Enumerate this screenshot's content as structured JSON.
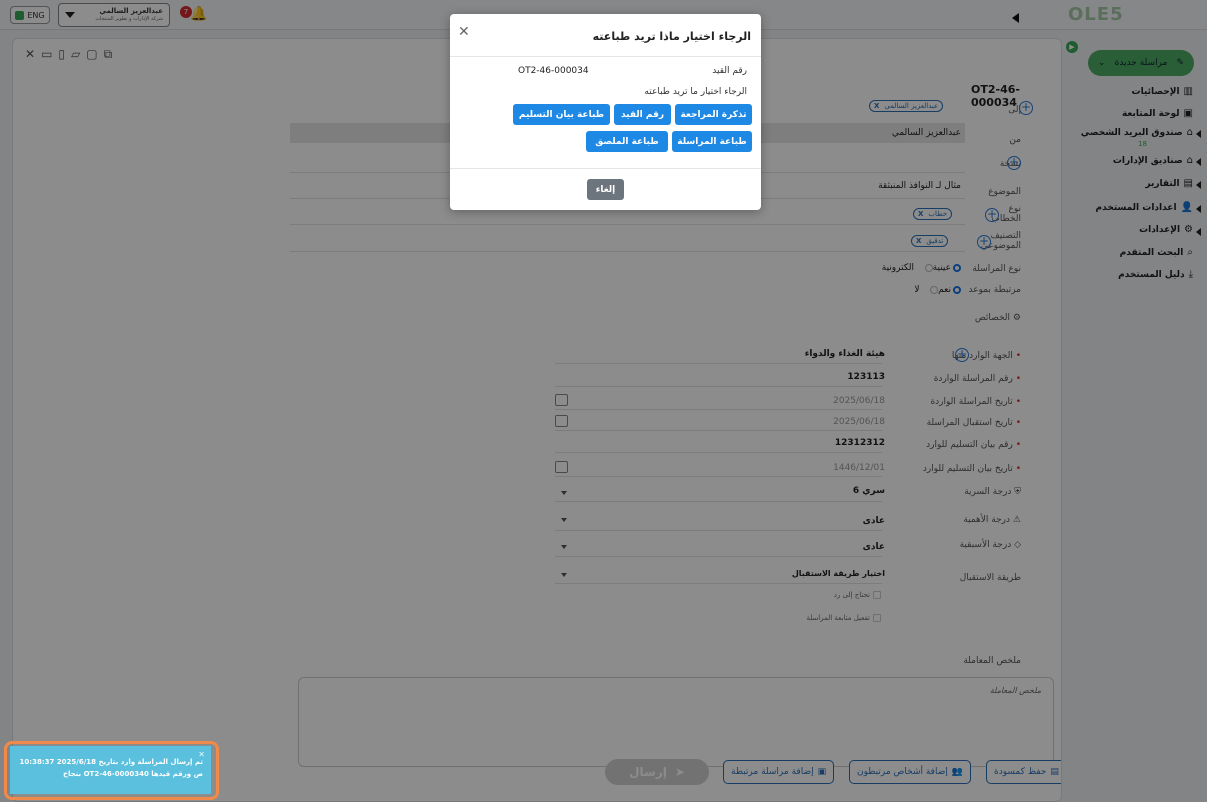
{
  "topbar": {
    "lang": "ENG",
    "user_name": "عبدالعزيز السالمي",
    "user_subtitle": "شركة الإدارات و تطوير المنتجات",
    "notif_count": "7",
    "logo": "OLE5"
  },
  "sidebar": {
    "new_button": "مراسلة جديدة",
    "items": [
      {
        "label": "الإحصائيات",
        "icon": "bar-chart-icon"
      },
      {
        "label": "لوحة المتابعة",
        "icon": "monitor-icon"
      },
      {
        "label": "صندوق البريد الشخصي",
        "icon": "inbox-icon",
        "count": "18"
      },
      {
        "label": "صناديق الإدارات",
        "icon": "inbox-icon"
      },
      {
        "label": "التقارير",
        "icon": "report-icon"
      },
      {
        "label": "اعدادات المستخدم",
        "icon": "user-settings-icon"
      },
      {
        "label": "الإعدادات",
        "icon": "gear-icon"
      },
      {
        "label": "البحث المتقدم",
        "icon": "search-icon"
      },
      {
        "label": "دليل المستخدم",
        "icon": "download-icon"
      }
    ]
  },
  "form": {
    "doc_number": "OT2-46-000034",
    "to_label": "إلى",
    "to_chip": "عبدالعزيز السالمي",
    "from_label": "من",
    "from_value": "عبدالعزيز السالمي",
    "cc_label": "نسخة",
    "subject_label": "الموضوع",
    "subject_value": "مثال لـ النوافذ المنبثقة",
    "letter_type_label": "نوع الخطاب",
    "letter_type_chip": "خطاب",
    "classification_label": "التصنيف الموضوعي",
    "classification_chip": "تدقيق",
    "mail_type_label": "نوع المراسلة",
    "mail_type_options": [
      "الكترونية",
      "عينية"
    ],
    "linked_label": "مرتبطة بموعد",
    "linked_options": [
      "نعم",
      "لا"
    ],
    "properties_label": "الخصائص",
    "sender_label": "الجهة الوارد منها",
    "sender_value": "هيئة الغذاء والدواء",
    "incoming_no_label": "رقم المراسلة الواردة",
    "incoming_no_value": "123113",
    "incoming_date_label": "تاريخ المراسلة الواردة",
    "incoming_date_value": "2025/06/18",
    "received_date_label": "تاريخ استقبال المراسلة",
    "received_date_value": "2025/06/18",
    "delivery_no_label": "رقم بيان التسليم للوارد",
    "delivery_no_value": "12312312",
    "delivery_date_label": "تاريخ بيان التسليم للوارد",
    "delivery_date_value": "1446/12/01",
    "secrecy_label": "درجة السرية",
    "secrecy_value": "سري 6",
    "importance_label": "درجة الأهمية",
    "importance_value": "عادى",
    "priority_label": "درجة الأسبقية",
    "priority_value": "عادى",
    "receive_method_label": "طريقة الاستقبال",
    "receive_method_value": "اختيار طريقة الاستقبال",
    "needs_reply": "تحتاج إلى رد",
    "enable_followup": "تفعيل متابعة المراسلة",
    "summary_label": "ملخص المعاملة",
    "summary_placeholder": "ملخص المعاملة"
  },
  "footer": {
    "save_draft": "حفظ كمسودة",
    "add_related_persons": "إضافة أشخاص مرتبطون",
    "add_related_mail": "إضافة مراسلة مرتبطة",
    "send": "إرسال"
  },
  "modal": {
    "title": "الرجاء اختيار ماذا تريد طباعته",
    "entry_label": "رقم القيد",
    "entry_value": "OT2-46-000034",
    "sub_prompt": "الرجاء اختيار ما تريد طباعته",
    "buttons": [
      "تذكرة المراجعة",
      "رقم القيد",
      "طباعة بيان التسليم",
      "طباعة المراسلة",
      "طباعة الملصق"
    ],
    "cancel": "إلغاء"
  },
  "toast": {
    "line1": "تم إرسال المراسلة وارد بتاريخ 2025/6/18 10:38:37",
    "line2": "بنجاح OT2-46-000034ص ورقم قيدها 0"
  },
  "colors": {
    "accent_green": "#4dab63",
    "primary_blue": "#1e88e5",
    "toast_bg": "#5bc0de",
    "toast_ring": "#f08a4b"
  }
}
